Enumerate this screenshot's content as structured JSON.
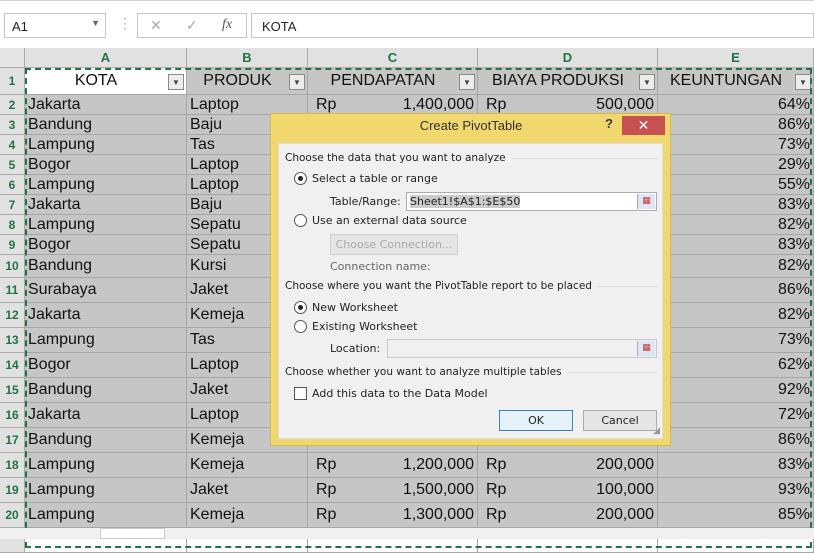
{
  "formula_bar": {
    "name_box": "A1",
    "cancel_icon": "✕",
    "enter_icon": "✓",
    "fx_label": "fx",
    "formula": "KOTA"
  },
  "columns": [
    "A",
    "B",
    "C",
    "D",
    "E"
  ],
  "headers": [
    "KOTA",
    "PRODUK",
    "PENDAPATAN",
    "BIAYA PRODUKSI",
    "KEUNTUNGAN"
  ],
  "rows": [
    {
      "n": "2",
      "kota": "Jakarta",
      "produk": "Laptop",
      "pendapatan": "1,400,000",
      "biaya": "500,000",
      "untung": "64%"
    },
    {
      "n": "3",
      "kota": "Bandung",
      "produk": "Baju",
      "pendapatan": "",
      "biaya": "",
      "untung": "86%"
    },
    {
      "n": "4",
      "kota": "Lampung",
      "produk": "Tas",
      "pendapatan": "",
      "biaya": "",
      "untung": "73%"
    },
    {
      "n": "5",
      "kota": "Bogor",
      "produk": "Laptop",
      "pendapatan": "",
      "biaya": "",
      "untung": "29%"
    },
    {
      "n": "6",
      "kota": "Lampung",
      "produk": "Laptop",
      "pendapatan": "",
      "biaya": "",
      "untung": "55%"
    },
    {
      "n": "7",
      "kota": "Jakarta",
      "produk": "Baju",
      "pendapatan": "",
      "biaya": "",
      "untung": "83%"
    },
    {
      "n": "8",
      "kota": "Lampung",
      "produk": "Sepatu",
      "pendapatan": "",
      "biaya": "",
      "untung": "82%"
    },
    {
      "n": "9",
      "kota": "Bogor",
      "produk": "Sepatu",
      "pendapatan": "",
      "biaya": "",
      "untung": "83%"
    },
    {
      "n": "10",
      "kota": "Bandung",
      "produk": "Kursi",
      "pendapatan": "",
      "biaya": "",
      "untung": "82%"
    },
    {
      "n": "11",
      "kota": "Surabaya",
      "produk": "Jaket",
      "pendapatan": "",
      "biaya": "",
      "untung": "86%"
    },
    {
      "n": "12",
      "kota": "Jakarta",
      "produk": "Kemeja",
      "pendapatan": "",
      "biaya": "",
      "untung": "82%"
    },
    {
      "n": "13",
      "kota": "Lampung",
      "produk": "Tas",
      "pendapatan": "",
      "biaya": "",
      "untung": "73%"
    },
    {
      "n": "14",
      "kota": "Bogor",
      "produk": "Laptop",
      "pendapatan": "",
      "biaya": "",
      "untung": "62%"
    },
    {
      "n": "15",
      "kota": "Bandung",
      "produk": "Jaket",
      "pendapatan": "",
      "biaya": "",
      "untung": "92%"
    },
    {
      "n": "16",
      "kota": "Jakarta",
      "produk": "Laptop",
      "pendapatan": "",
      "biaya": "",
      "untung": "72%"
    },
    {
      "n": "17",
      "kota": "Bandung",
      "produk": "Kemeja",
      "pendapatan": "",
      "biaya": "",
      "untung": "86%"
    },
    {
      "n": "18",
      "kota": "Lampung",
      "produk": "Kemeja",
      "pendapatan": "1,200,000",
      "biaya": "200,000",
      "untung": "83%"
    },
    {
      "n": "19",
      "kota": "Lampung",
      "produk": "Jaket",
      "pendapatan": "1,500,000",
      "biaya": "100,000",
      "untung": "93%"
    },
    {
      "n": "20",
      "kota": "Lampung",
      "produk": "Kemeja",
      "pendapatan": "1,300,000",
      "biaya": "200,000",
      "untung": "85%"
    }
  ],
  "currency": "Rp",
  "dialog": {
    "title": "Create PivotTable",
    "help": "?",
    "close": "✕",
    "section1": "Choose the data that you want to analyze",
    "opt_table": "Select a table or range",
    "table_range_label": "Table/Range:",
    "table_range_value": "Sheet1!$A$1:$E$50",
    "opt_external": "Use an external data source",
    "choose_connection": "Choose Connection...",
    "connection_name": "Connection name:",
    "section2": "Choose where you want the PivotTable report to be placed",
    "opt_new": "New Worksheet",
    "opt_existing": "Existing Worksheet",
    "location_label": "Location:",
    "location_value": "",
    "section3": "Choose whether you want to analyze multiple tables",
    "data_model": "Add this data to the Data Model",
    "ok": "OK",
    "cancel": "Cancel"
  },
  "colors": {
    "accent": "#217346",
    "dialog_frame": "#f0d86f",
    "close": "#c75050"
  }
}
